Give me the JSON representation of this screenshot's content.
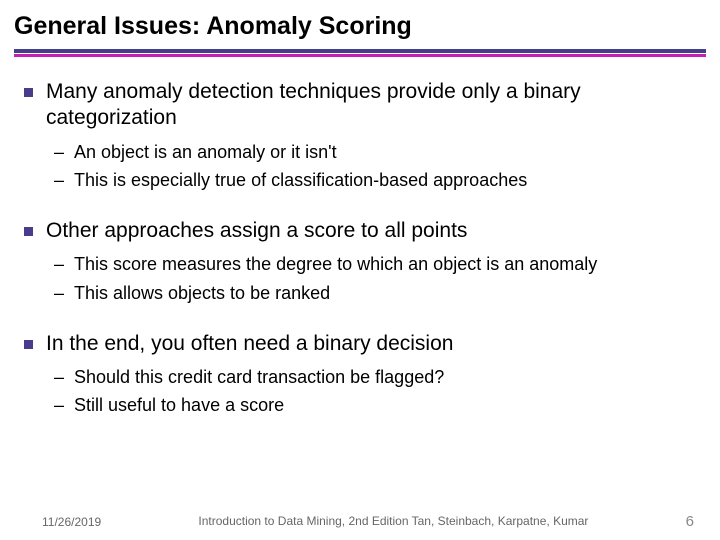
{
  "title": "General Issues: Anomaly Scoring",
  "bullets": [
    {
      "text": "Many anomaly detection techniques provide only a binary categorization",
      "subs": [
        "An object is an anomaly or it isn't",
        "This is especially true of classification-based approaches"
      ]
    },
    {
      "text": "Other approaches assign a score to all points",
      "subs": [
        "This score measures the degree to which an object is an anomaly",
        "This allows objects to be ranked"
      ]
    },
    {
      "text": "In the end, you often need a binary decision",
      "subs": [
        "Should this credit card transaction be flagged?",
        "Still useful to have a score"
      ]
    }
  ],
  "footer": {
    "date": "11/26/2019",
    "source": "Introduction to Data Mining, 2nd Edition   Tan, Steinbach, Karpatne, Kumar",
    "page": "6"
  }
}
